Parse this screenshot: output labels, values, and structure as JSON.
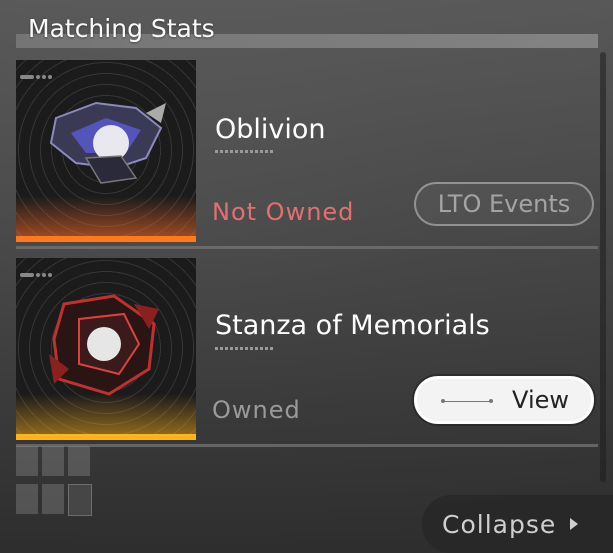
{
  "header": {
    "title": "Matching Stats"
  },
  "items": [
    {
      "name": "Oblivion",
      "status": "Not Owned",
      "action_label": "LTO Events",
      "status_color": "#e27070",
      "accent_color": "#ff7a1a"
    },
    {
      "name": "Stanza of Memorials",
      "status": "Owned",
      "action_label": "View",
      "status_color": "#9a9a9a",
      "accent_color": "#ffb41e"
    }
  ],
  "footer": {
    "collapse_label": "Collapse"
  }
}
